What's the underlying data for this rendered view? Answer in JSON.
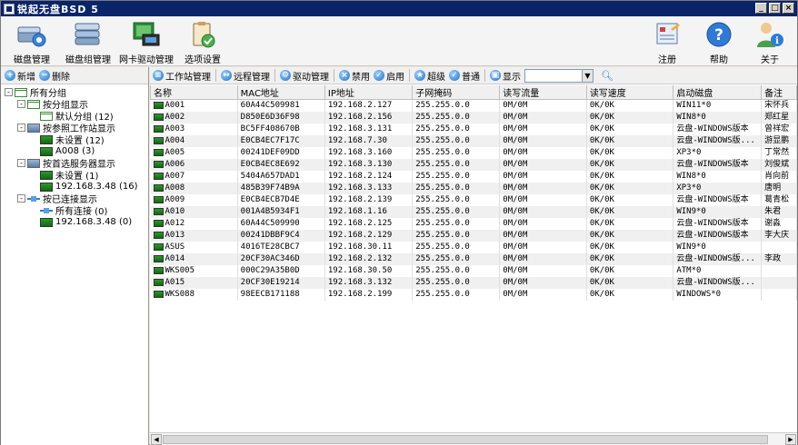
{
  "window": {
    "title": "锐起无盘BSD 5",
    "btn_min": "_",
    "btn_max": "□",
    "btn_close": "×"
  },
  "toolbar": {
    "left": [
      {
        "label": "磁盘管理",
        "icon": "disk-gear-icon"
      },
      {
        "label": "磁盘组管理",
        "icon": "disk-group-icon"
      },
      {
        "label": "网卡驱动管理",
        "icon": "nic-driver-icon"
      },
      {
        "label": "选项设置",
        "icon": "clipboard-check-icon"
      }
    ],
    "right": [
      {
        "label": "注册",
        "icon": "register-icon"
      },
      {
        "label": "帮助",
        "icon": "help-icon"
      },
      {
        "label": "关于",
        "icon": "about-icon"
      }
    ]
  },
  "left_tools": {
    "add": "新增",
    "delete": "删除"
  },
  "tree": [
    {
      "label": "所有分组",
      "level": 0,
      "expand": "-",
      "icon": "grid"
    },
    {
      "label": "按分组显示",
      "level": 1,
      "expand": "-",
      "icon": "grid"
    },
    {
      "label": "默认分组 (12)",
      "level": 2,
      "expand": "",
      "icon": "grid"
    },
    {
      "label": "按参照工作站显示",
      "level": 1,
      "expand": "-",
      "icon": "srv"
    },
    {
      "label": "未设置 (12)",
      "level": 2,
      "expand": "",
      "icon": "mon"
    },
    {
      "label": "A008 (3)",
      "level": 2,
      "expand": "",
      "icon": "mon"
    },
    {
      "label": "按首选服务器显示",
      "level": 1,
      "expand": "-",
      "icon": "srv"
    },
    {
      "label": "未设置 (1)",
      "level": 2,
      "expand": "",
      "icon": "mon"
    },
    {
      "label": "192.168.3.48 (16)",
      "level": 2,
      "expand": "",
      "icon": "mon"
    },
    {
      "label": "按已连接显示",
      "level": 1,
      "expand": "-",
      "icon": "net"
    },
    {
      "label": "所有连接 (0)",
      "level": 2,
      "expand": "",
      "icon": "net"
    },
    {
      "label": "192.168.3.48 (0)",
      "level": 2,
      "expand": "",
      "icon": "mon"
    }
  ],
  "right_tools": {
    "ws_mgmt": "工作站管理",
    "remote": "远程管理",
    "driver": "驱动管理",
    "disable": "禁用",
    "enable": "启用",
    "super": "超级",
    "normal": "普通",
    "show": "显示",
    "filter_value": ""
  },
  "table": {
    "columns": [
      "名称",
      "MAC地址",
      "IP地址",
      "子网掩码",
      "读写流量",
      "读写速度",
      "启动磁盘",
      "备注"
    ],
    "rows": [
      [
        "A001",
        "60A44C509981",
        "192.168.2.127",
        "255.255.0.0",
        "0M/0M",
        "0K/0K",
        "WIN11*0",
        "宋怀兵"
      ],
      [
        "A002",
        "D850E6D36F98",
        "192.168.2.156",
        "255.255.0.0",
        "0M/0M",
        "0K/0K",
        "WIN8*0",
        "郑红星"
      ],
      [
        "A003",
        "BC5FF408670B",
        "192.168.3.131",
        "255.255.0.0",
        "0M/0M",
        "0K/0K",
        "云盘-WINDOWS版本",
        "曾祥宏"
      ],
      [
        "A004",
        "E0CB4EC7F17C",
        "192.168.7.30",
        "255.255.0.0",
        "0M/0M",
        "0K/0K",
        "云盘-WINDOWS版...",
        "游显鹏"
      ],
      [
        "A005",
        "00241DEF09DD",
        "192.168.3.160",
        "255.255.0.0",
        "0M/0M",
        "0K/0K",
        "XP3*0",
        "丁常然"
      ],
      [
        "A006",
        "E0CB4EC8E692",
        "192.168.3.130",
        "255.255.0.0",
        "0M/0M",
        "0K/0K",
        "云盘-WINDOWS版本",
        "刘俊斌"
      ],
      [
        "A007",
        "5404A657DAD1",
        "192.168.2.124",
        "255.255.0.0",
        "0M/0M",
        "0K/0K",
        "WIN8*0",
        "肖向前"
      ],
      [
        "A008",
        "485B39F74B9A",
        "192.168.3.133",
        "255.255.0.0",
        "0M/0M",
        "0K/0K",
        "XP3*0",
        "唐明"
      ],
      [
        "A009",
        "E0CB4ECB7D4E",
        "192.168.2.139",
        "255.255.0.0",
        "0M/0M",
        "0K/0K",
        "云盘-WINDOWS版本",
        "葛青松"
      ],
      [
        "A010",
        "001A4B5934F1",
        "192.168.1.16",
        "255.255.0.0",
        "0M/0M",
        "0K/0K",
        "WIN9*0",
        "朱君"
      ],
      [
        "A012",
        "60A44C509990",
        "192.168.2.125",
        "255.255.0.0",
        "0M/0M",
        "0K/0K",
        "云盘-WINDOWS版本",
        "谢淼"
      ],
      [
        "A013",
        "00241DBBF9C4",
        "192.168.2.129",
        "255.255.0.0",
        "0M/0M",
        "0K/0K",
        "云盘-WINDOWS版本",
        "李大庆"
      ],
      [
        "ASUS",
        "4016TE28CBC7",
        "192.168.30.11",
        "255.255.0.0",
        "0M/0M",
        "0K/0K",
        "WIN9*0",
        ""
      ],
      [
        "A014",
        "20CF30AC346D",
        "192.168.2.132",
        "255.255.0.0",
        "0M/0M",
        "0K/0K",
        "云盘-WINDOWS版...",
        "李政"
      ],
      [
        "WKS005",
        "000C29A35B0D",
        "192.168.30.50",
        "255.255.0.0",
        "0M/0M",
        "0K/0K",
        "ATM*0",
        ""
      ],
      [
        "A015",
        "20CF30E19214",
        "192.168.3.132",
        "255.255.0.0",
        "0M/0M",
        "0K/0K",
        "云盘-WINDOWS版...",
        ""
      ],
      [
        "WKS088",
        "98EECB171188",
        "192.168.2.199",
        "255.255.0.0",
        "0M/0M",
        "0K/0K",
        "WINDOWS*0",
        ""
      ]
    ]
  }
}
